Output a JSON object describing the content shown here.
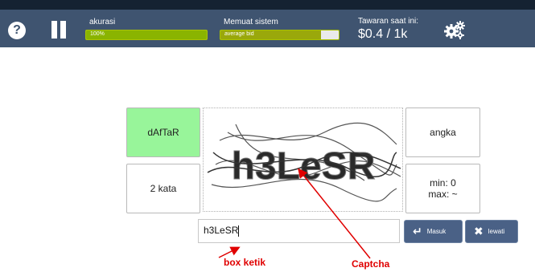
{
  "header": {
    "help_icon": "help-icon",
    "pause_icon": "pause-icon",
    "settings_icon": "gears-icon",
    "accuracy": {
      "label": "akurasi",
      "bar_text": "100%",
      "value_pct": 100
    },
    "system_load": {
      "label": "Memuat sistem",
      "bar_text": "average bid",
      "value_pct": 85
    },
    "offer": {
      "label": "Tawaran saat ini:",
      "value": "$0.4 / 1k"
    }
  },
  "tiles": {
    "register": "dAfTaR",
    "two_words": "2 kata",
    "numbers": "angka",
    "min_max": "min: 0\nmax: ~"
  },
  "captcha": {
    "text": "h3LeSR"
  },
  "input": {
    "value": "h3LeSR"
  },
  "buttons": {
    "submit": {
      "label": "Masuk",
      "icon": "return-arrow-icon"
    },
    "skip": {
      "label": "lewati",
      "icon": "x-icon"
    }
  },
  "annotations": {
    "typing_box": "box ketik",
    "captcha": "Captcha"
  },
  "colors": {
    "header_bg": "#3f5470",
    "top_strip": "#152232",
    "tile_green": "#98f59a",
    "bar_fill": "#8ab400",
    "button_bg": "#4a6186",
    "annotation": "#e00000"
  }
}
